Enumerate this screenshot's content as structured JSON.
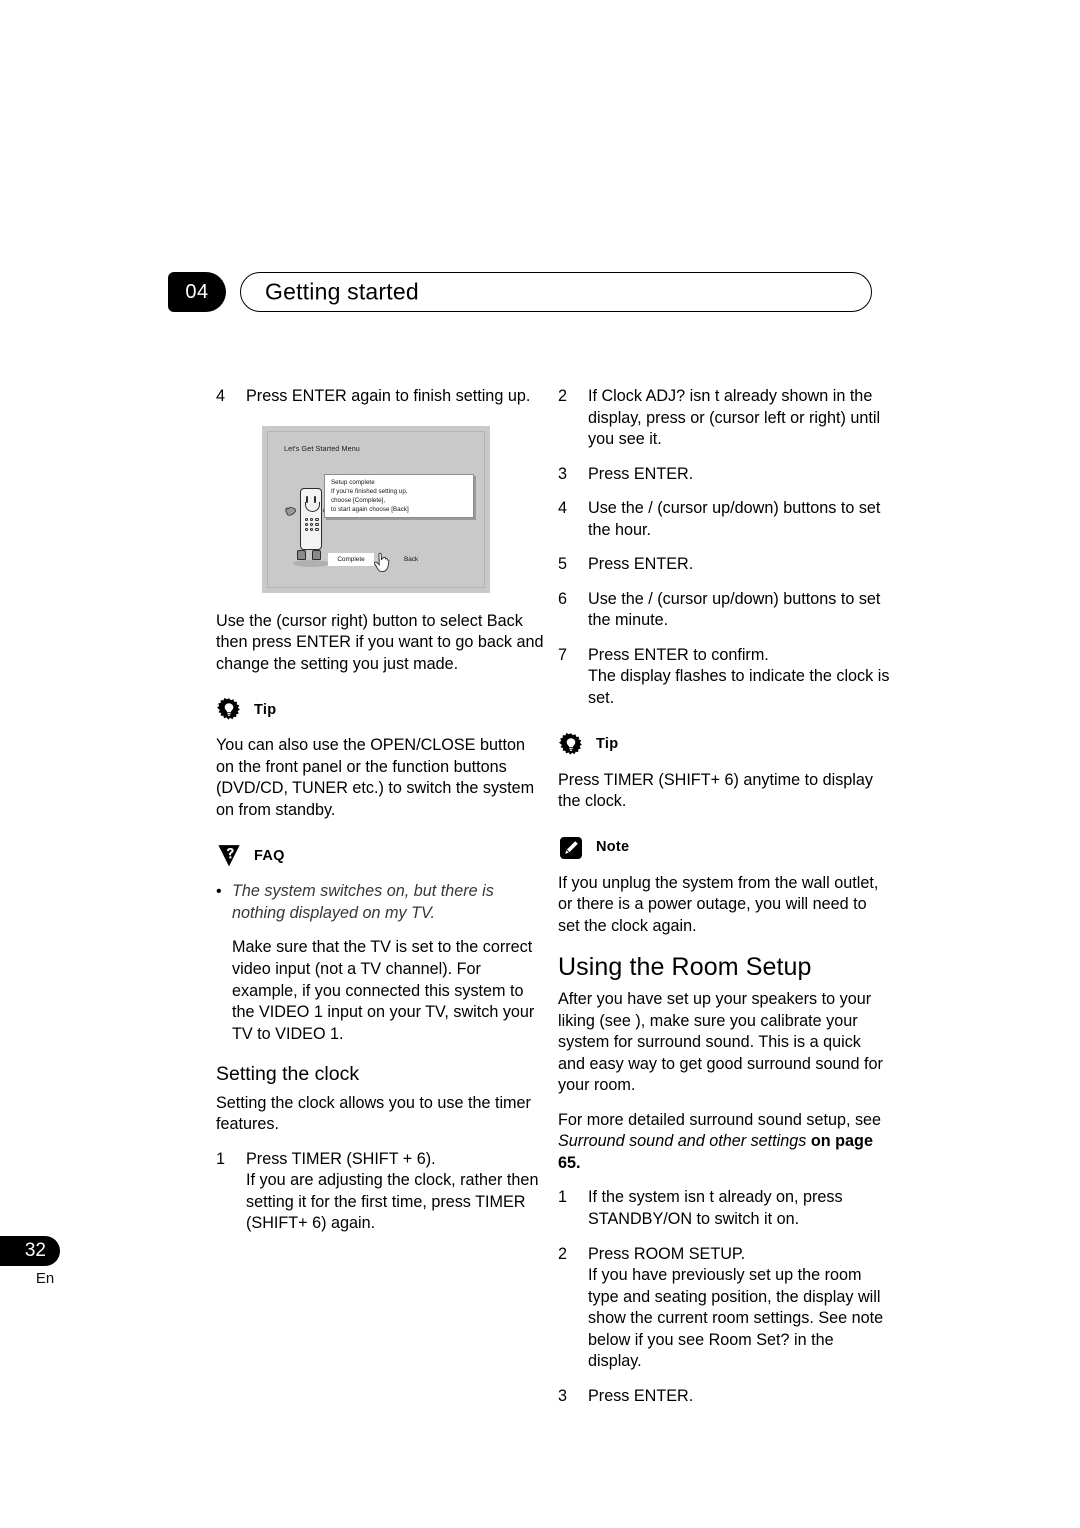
{
  "header": {
    "chapter_number": "04",
    "chapter_title": "Getting started"
  },
  "footer": {
    "page_number": "32",
    "language_code": "En"
  },
  "left_column": {
    "step4": {
      "number": "4",
      "text": "Press ENTER again to finish setting up."
    },
    "figure": {
      "title": "Let's Get Started Menu",
      "dialog_lines": [
        "Setup complete",
        "If you're finished setting up,",
        "choose [Complete],",
        "to start again choose [Back]"
      ],
      "button_complete": "Complete",
      "button_back": "Back"
    },
    "after_figure_text": "Use the  (cursor right) button to select Back then press ENTER if you want to go back and change the setting you just made.",
    "tip": {
      "label": "Tip",
      "text": "You can also use the  OPEN/CLOSE button on the front panel or the function buttons (DVD/CD, TUNER etc.) to switch the system on from standby."
    },
    "faq": {
      "label": "FAQ",
      "bullet": "•",
      "question": "The system switches on, but there is nothing displayed on my TV.",
      "answer": "Make sure that the TV is set to the correct video input (not a TV channel). For example, if you connected this system to the VIDEO 1 input on your TV, switch your TV to VIDEO 1."
    },
    "setting_the_clock": {
      "heading": "Setting the clock",
      "intro": "Setting the clock allows you to use the timer features.",
      "step1": {
        "number": "1",
        "text": "Press TIMER (SHIFT + 6).",
        "sub": "If you are adjusting the clock, rather then setting it for the first time, press TIMER (SHIFT+ 6) again."
      }
    }
  },
  "right_column": {
    "step2": {
      "number": "2",
      "text": "If  Clock ADJ?  isn t already shown in the display, press  or  (cursor left or right) until you see it."
    },
    "step3": {
      "number": "3",
      "text": "Press ENTER."
    },
    "step4": {
      "number": "4",
      "text": "Use the  /  (cursor up/down) buttons to set the hour."
    },
    "step5": {
      "number": "5",
      "text": "Press ENTER."
    },
    "step6": {
      "number": "6",
      "text": "Use the  /  (cursor up/down) buttons to set the minute."
    },
    "step7": {
      "number": "7",
      "text": "Press ENTER to confirm.",
      "sub": "The display flashes to indicate the clock is set."
    },
    "tip": {
      "label": "Tip",
      "text": "Press TIMER (SHIFT+ 6) anytime to display the clock."
    },
    "note": {
      "label": "Note",
      "text": "If you unplug the system from the wall outlet, or there is a power outage, you will need to set the clock again."
    },
    "room_setup": {
      "heading": "Using the Room Setup",
      "intro": "After you have set up your speakers to your liking (see ), make sure you calibrate your system for surround sound. This is a quick and easy way to get good surround sound for your room.",
      "cross_ref_prefix": "For more detailed surround sound setup, see ",
      "cross_ref_italic": "Surround sound and other settings",
      "cross_ref_bold": " on page 65.",
      "step1": {
        "number": "1",
        "text": "If the system isn t already on, press STANDBY/ON to switch it on."
      },
      "step2": {
        "number": "2",
        "text": "Press ROOM SETUP.",
        "sub": "If you have previously set up the room type and seating position, the display will show the current room settings. See note below if you see Room Set? in the display."
      },
      "step3": {
        "number": "3",
        "text": "Press ENTER."
      }
    }
  }
}
